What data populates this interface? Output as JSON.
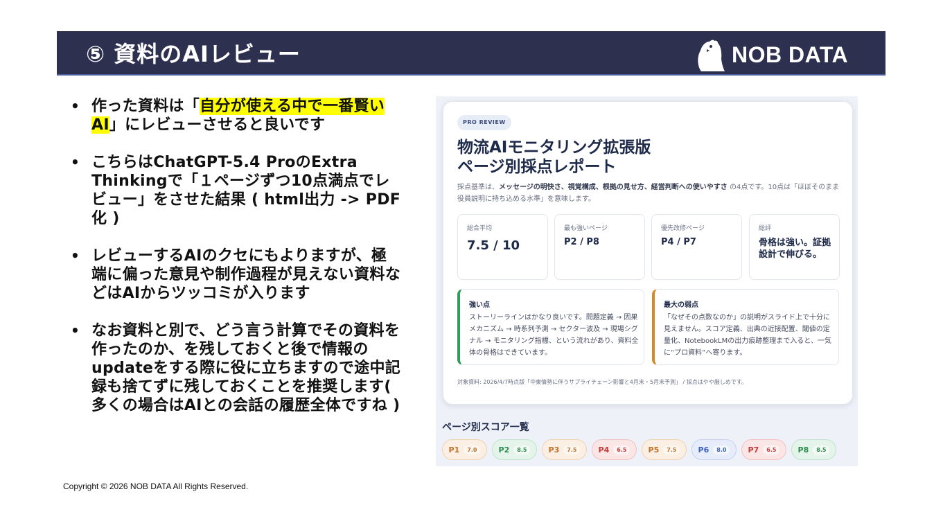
{
  "slide": {
    "title": "⑤ 資料のAIレビュー",
    "logo_text": "NOB DATA",
    "copyright": "Copyright © 2026 NOB DATA All Rights Reserved."
  },
  "bullets": [
    {
      "marker": "•",
      "pre": "作った資料は「",
      "highlight": "自分が使える中で一番賢いAI",
      "post": "」にレビューさせると良いです"
    },
    {
      "marker": "•",
      "text": "こちらはChatGPT-5.4 ProのExtra Thinkingで「１ページずつ10点満点でレビュー」をさせた結果 ( html出力 -> PDF化 )"
    },
    {
      "marker": "•",
      "text": "レビューするAIのクセにもよりますが、極端に偏った意見や制作過程が見えない資料などはAIからツッコミが入ります"
    },
    {
      "marker": "•",
      "text": "なお資料と別で、どう言う計算でその資料を作ったのか、を残しておくと後で情報のupdateをする際に役に立ちますので途中記録も捨てずに残しておくことを推奨します( 多くの場合はAIとの会話の履歴全体ですね )"
    }
  ],
  "review": {
    "badge": "PRO REVIEW",
    "title_line1": "物流AIモニタリング拡張版",
    "title_line2": "ページ別採点レポート",
    "desc_pre": "採点基準は、",
    "desc_bold": "メッセージの明快さ、視覚構成、根拠の見せ方、経営判断への使いやすさ",
    "desc_post": " の4点です。10点は「ほぼそのまま役員説明に持ち込める水準」を意味します。",
    "stats": [
      {
        "label": "総合平均",
        "value": "7.5 / 10"
      },
      {
        "label": "最も強いページ",
        "value": "P2 / P8"
      },
      {
        "label": "優先改修ページ",
        "value": "P4 / P7"
      },
      {
        "label": "総評",
        "value": "骨格は強い。証拠設計で伸びる。"
      }
    ],
    "strength_title": "強い点",
    "strength_body": "ストーリーラインはかなり良いです。問題定義 → 因果メカニズム → 時系列予測 → セクター波及 → 現場シグナル → モニタリング指標、という流れがあり、資料全体の骨格はできています。",
    "weakness_title": "最大の弱点",
    "weakness_body": "「なぜその点数なのか」の説明がスライド上で十分に見えません。スコア定義、出典の近接配置、閾値の定量化、NotebookLMの出力痕跡整理まで入ると、一気に“プロ資料”へ寄ります。",
    "source": "対象資料: 2026/4/7時点版「中東情勢に伴うサプライチェーン影響と4月末・5月末予測」 / 採点はやや厳しめです。",
    "scores_title": "ページ別スコア一覧",
    "scores": [
      {
        "page": "P1",
        "score": "7.0",
        "fg": "#c0702a",
        "bg": "#fbeee2",
        "border": "#f0d2b4"
      },
      {
        "page": "P2",
        "score": "8.5",
        "fg": "#2a8a4c",
        "bg": "#e4f4ea",
        "border": "#bfe3cb"
      },
      {
        "page": "P3",
        "score": "7.5",
        "fg": "#c0702a",
        "bg": "#fbeee2",
        "border": "#f0d2b4"
      },
      {
        "page": "P4",
        "score": "6.5",
        "fg": "#c23a3a",
        "bg": "#fbe5e5",
        "border": "#f0c2c2"
      },
      {
        "page": "P5",
        "score": "7.5",
        "fg": "#c0702a",
        "bg": "#fbeee2",
        "border": "#f0d2b4"
      },
      {
        "page": "P6",
        "score": "8.0",
        "fg": "#3a5fc2",
        "bg": "#e6ecfa",
        "border": "#c6d2f0"
      },
      {
        "page": "P7",
        "score": "6.5",
        "fg": "#c23a3a",
        "bg": "#fbe5e5",
        "border": "#f0c2c2"
      },
      {
        "page": "P8",
        "score": "8.5",
        "fg": "#2a8a4c",
        "bg": "#e4f4ea",
        "border": "#bfe3cb"
      }
    ]
  }
}
